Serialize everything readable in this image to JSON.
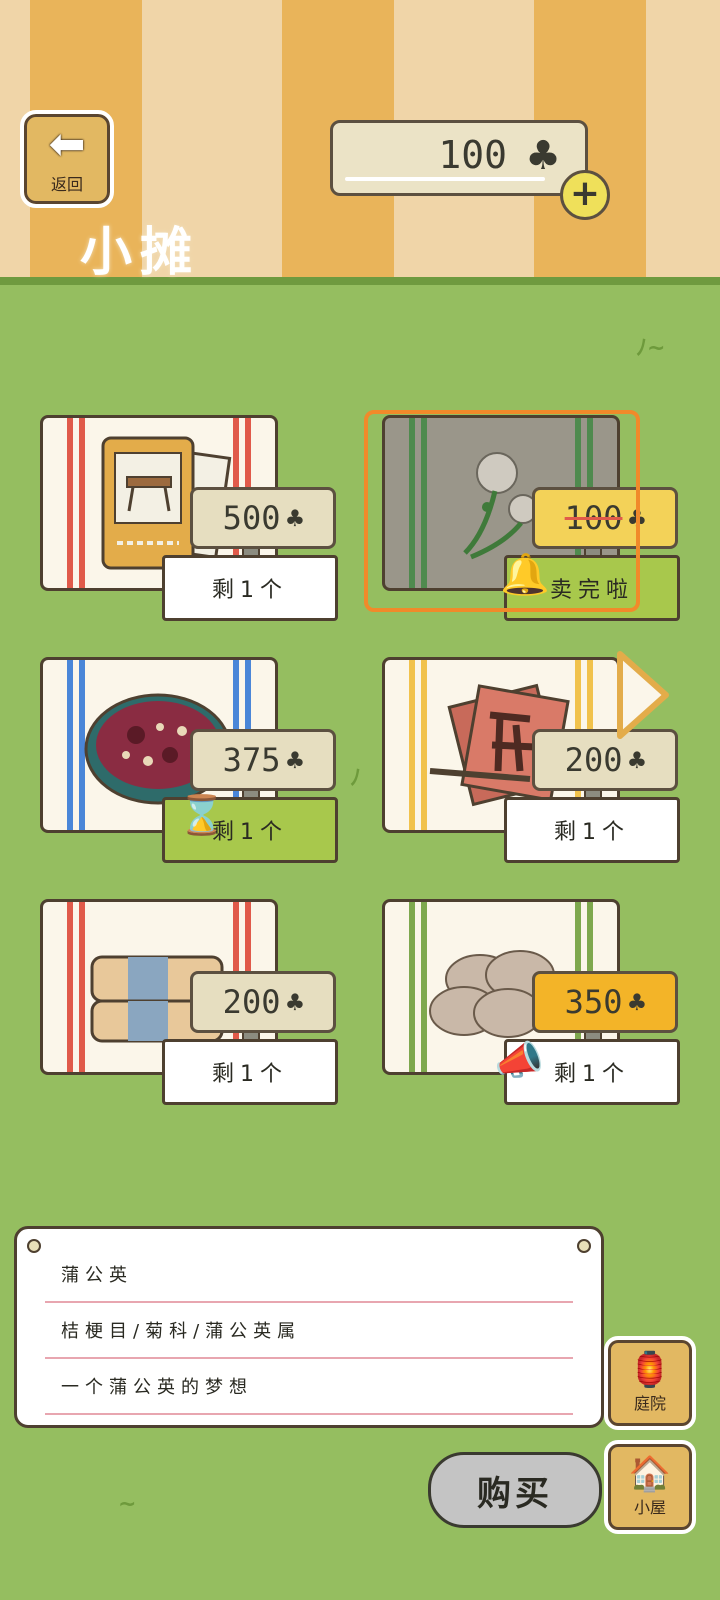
{
  "header": {
    "back_label": "返回",
    "title": "小摊",
    "coins": "100",
    "coin_icon": "clover-icon"
  },
  "items": [
    {
      "name": "bench-card",
      "price": "500",
      "stock": "剩1个",
      "state": "normal"
    },
    {
      "name": "dandelion",
      "price": "100",
      "stock": "卖完啦",
      "state": "sold-out"
    },
    {
      "name": "bean-porridge",
      "price": "375",
      "stock": "剩1个",
      "state": "timed"
    },
    {
      "name": "calligraphy",
      "price": "200",
      "stock": "剩1个",
      "state": "normal"
    },
    {
      "name": "cloth-bundle",
      "price": "200",
      "stock": "剩1个",
      "state": "normal"
    },
    {
      "name": "shell-cookies",
      "price": "350",
      "stock": "剩1个",
      "state": "highlight"
    }
  ],
  "detail": {
    "name": "蒲公英",
    "taxonomy": "桔梗目/菊科/蒲公英属",
    "description": "一个蒲公英的梦想"
  },
  "buttons": {
    "buy": "购买",
    "yard": "庭院",
    "house": "小屋"
  },
  "colors": {
    "grass": "#95be60",
    "stripe_orange": "#e9b45a",
    "stripe_cream": "#f0d5a8",
    "selection": "#f18a2a"
  }
}
